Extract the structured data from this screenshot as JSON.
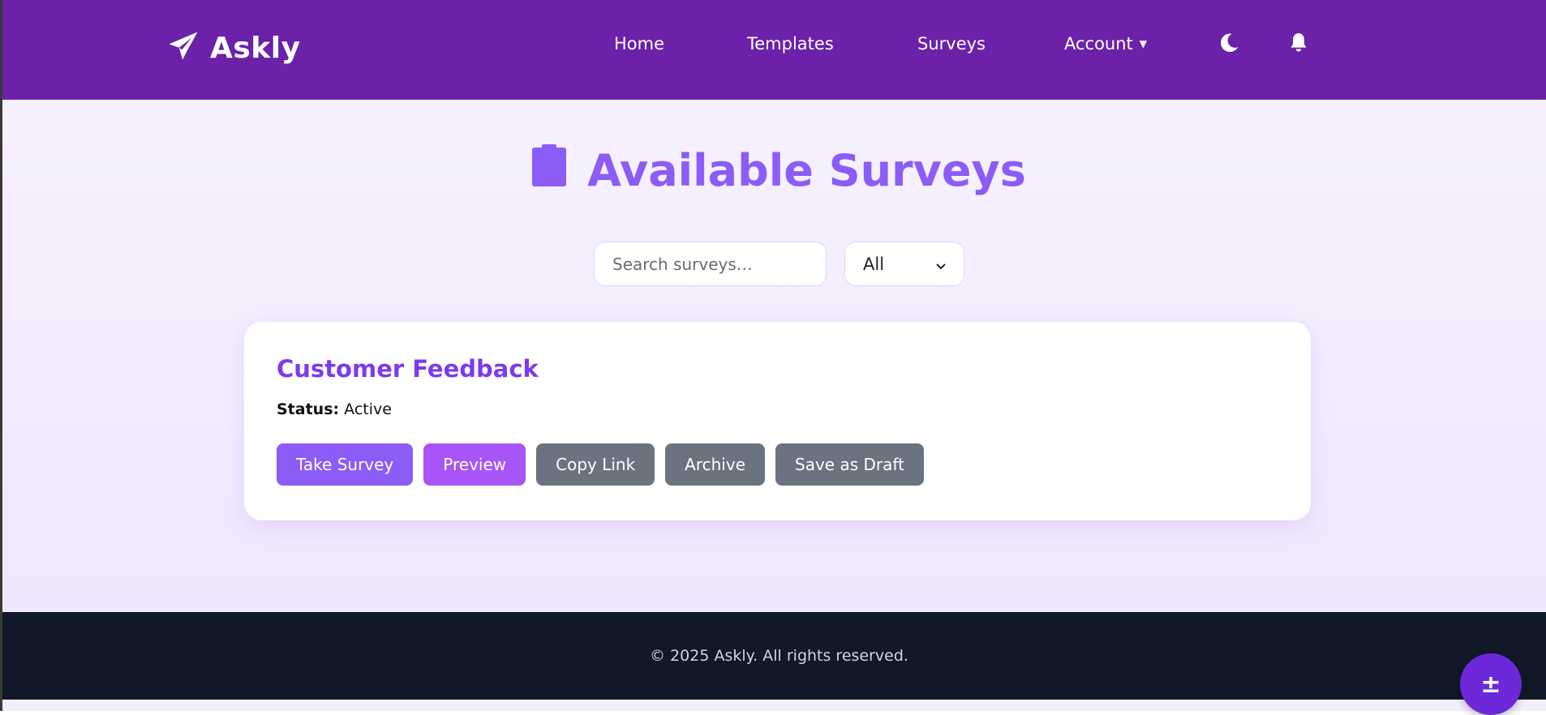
{
  "brand": {
    "name": "Askly",
    "icon": "paper-plane-icon"
  },
  "nav": {
    "home": "Home",
    "templates": "Templates",
    "surveys": "Surveys",
    "account": "Account",
    "account_caret": "▼",
    "theme_icon": "moon-icon",
    "notifications_icon": "bell-icon"
  },
  "page": {
    "title": "Available Surveys",
    "title_icon": "clipboard-icon"
  },
  "search": {
    "placeholder": "Search surveys…",
    "value": ""
  },
  "filter": {
    "selected": "All"
  },
  "surveys": [
    {
      "title": "Customer Feedback",
      "status_label": "Status:",
      "status": "Active",
      "actions": {
        "take": "Take Survey",
        "preview": "Preview",
        "copy": "Copy Link",
        "archive": "Archive",
        "draft": "Save as Draft"
      }
    }
  ],
  "footer": {
    "text": "© 2025 Askly. All rights reserved."
  },
  "fab": {
    "label": "±"
  },
  "colors": {
    "navbar": "#6b21a8",
    "accent": "#8b5cf6",
    "preview": "#a855f7",
    "secondary": "#6b7280",
    "footer": "#111827",
    "fab": "#6d28d9"
  }
}
